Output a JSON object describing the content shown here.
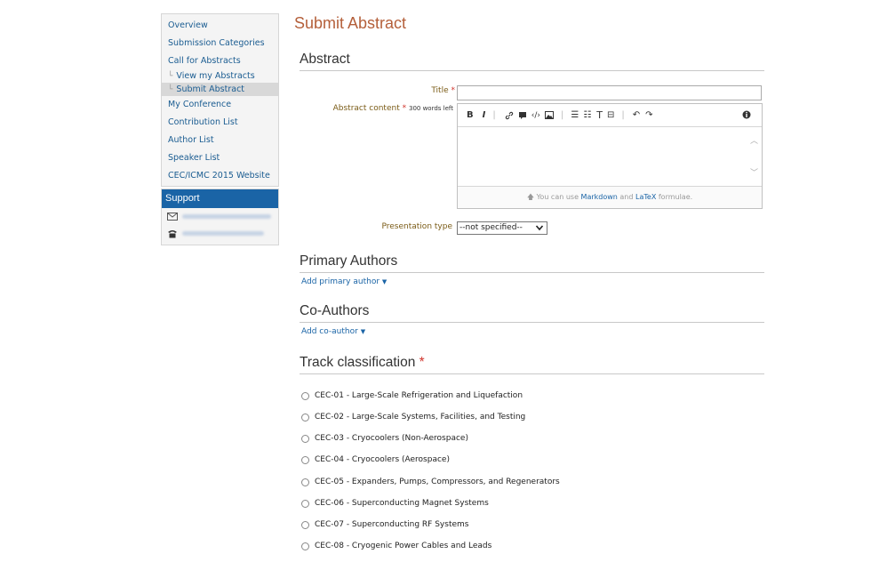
{
  "sidebar": {
    "items": [
      {
        "label": "Overview"
      },
      {
        "label": "Submission Categories"
      },
      {
        "label": "Call for Abstracts"
      },
      {
        "label": "View my Abstracts"
      },
      {
        "label": "Submit Abstract"
      },
      {
        "label": "My Conference"
      },
      {
        "label": "Contribution List"
      },
      {
        "label": "Author List"
      },
      {
        "label": "Speaker List"
      },
      {
        "label": "CEC/ICMC 2015 Website"
      }
    ],
    "corner_glyph": "└"
  },
  "support": {
    "title": "Support"
  },
  "main": {
    "page_title": "Submit Abstract",
    "abstract_section": "Abstract",
    "title_label": "Title",
    "required_mark": "*",
    "content_label": "Abstract content",
    "words_left": "300 words left",
    "toolbar": {
      "bold": "B",
      "italic": "I",
      "text": "T"
    },
    "hint": {
      "prefix": "You can use",
      "markdown": "Markdown",
      "and": "and",
      "latex": "LaTeX",
      "suffix": "formulae."
    },
    "presentation_label": "Presentation type",
    "presentation_value": "--not specified--",
    "primary_authors": "Primary Authors",
    "add_primary": "Add primary author",
    "co_authors": "Co-Authors",
    "add_co": "Add co-author",
    "track_heading": "Track classification",
    "tracks": [
      "CEC-01 - Large-Scale Refrigeration and Liquefaction",
      "CEC-02 - Large-Scale Systems, Facilities, and Testing",
      "CEC-03 - Cryocoolers (Non-Aerospace)",
      "CEC-04 - Cryocoolers (Aerospace)",
      "CEC-05 - Expanders, Pumps, Compressors, and Regenerators",
      "CEC-06 - Superconducting Magnet Systems",
      "CEC-07 - Superconducting RF Systems",
      "CEC-08 - Cryogenic Power Cables and Leads"
    ]
  },
  "colors": {
    "accent": "#b45f3a",
    "link": "#1a64a6",
    "support_header": "#1a64a6"
  }
}
